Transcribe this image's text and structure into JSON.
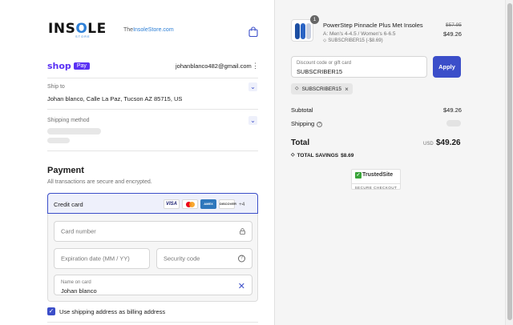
{
  "header": {
    "logo_text": "INSOLE",
    "logo_sub": "STORE",
    "logo_site_prefix": "The",
    "logo_site_main": "InsoleStore",
    "logo_site_suffix": ".com",
    "cart_icon": "shopping-bag-icon"
  },
  "account": {
    "shop_label": "shop",
    "pay_label": "Pay",
    "email": "johanblanco482@gmail.com",
    "menu_icon": "kebab-icon"
  },
  "ship_to": {
    "label": "Ship to",
    "value": "Johan blanco, Calle La Paz, Tucson AZ 85715, US"
  },
  "shipping_method": {
    "label": "Shipping method"
  },
  "payment": {
    "title": "Payment",
    "subtitle": "All transactions are secure and encrypted.",
    "method_label": "Credit card",
    "cards": [
      "VISA",
      "",
      "AMEX",
      "DISCOVER"
    ],
    "more_cards": "+4",
    "card_number_placeholder": "Card number",
    "expiration_placeholder": "Expiration date (MM / YY)",
    "security_placeholder": "Security code",
    "name_label": "Name on card",
    "name_value": "Johan blanco",
    "billing_checkbox_label": "Use shipping address as billing address"
  },
  "summary": {
    "item": {
      "quantity": "1",
      "name": "PowerStep Pinnacle Plus Met Insoles",
      "variant": "A: Men's 4-4.5 / Women's 6-6.5",
      "discount": "SUBSCRIBER15 (-$8.69)",
      "original_price": "$57.95",
      "price": "$49.26"
    },
    "discount_field_label": "Discount code or gift card",
    "discount_field_value": "SUBSCRIBER15",
    "apply_label": "Apply",
    "applied_code": "SUBSCRIBER15",
    "subtotal_label": "Subtotal",
    "subtotal_value": "$49.26",
    "shipping_label": "Shipping",
    "total_label": "Total",
    "currency": "USD",
    "total_value": "$49.26",
    "savings_label": "TOTAL SAVINGS",
    "savings_value": "$8.69",
    "badge_title": "TrustedSite",
    "badge_sub": "SECURE CHECKOUT"
  },
  "colors": {
    "accent": "#3b4ec9",
    "shop_pay": "#5a31f4",
    "logo_blue": "#2d7fd6",
    "trusted_green": "#3aa53a"
  }
}
